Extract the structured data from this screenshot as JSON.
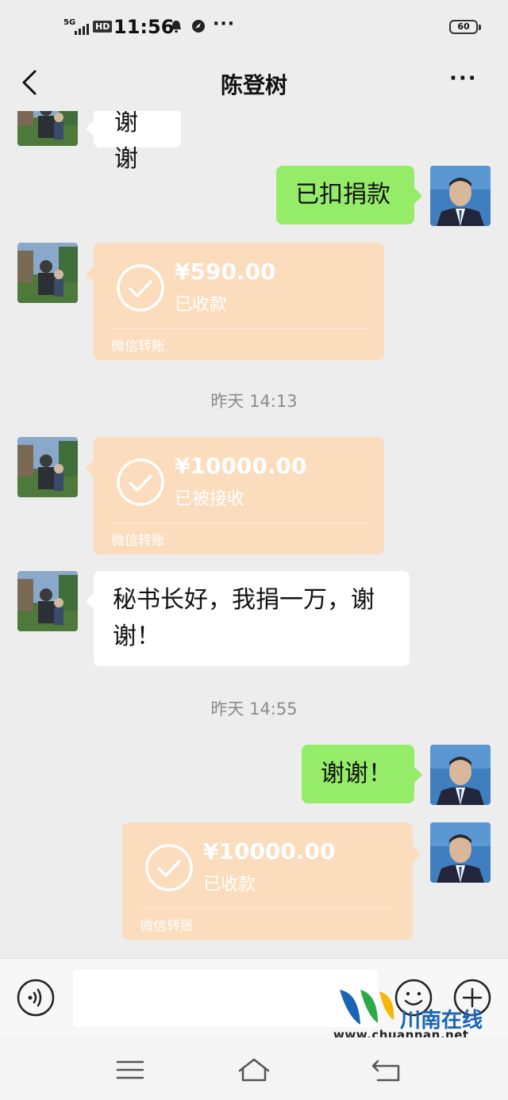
{
  "status_bar": {
    "network": "5G",
    "hd": "HD",
    "time": "11:56",
    "more": "···",
    "battery": "60"
  },
  "header": {
    "title": "陈登树",
    "more": "···"
  },
  "messages": {
    "m0": {
      "text": "谢谢"
    },
    "m1": {
      "text": "已扣捐款"
    },
    "m2": {
      "amount": "¥590.00",
      "status": "已收款",
      "footer": "微信转账"
    },
    "t1": {
      "text": "昨天 14:13"
    },
    "m3": {
      "amount": "¥10000.00",
      "status": "已被接收",
      "footer": "微信转账"
    },
    "m4": {
      "line1": "秘书长好，我捐一万，谢",
      "line2": "谢！"
    },
    "t2": {
      "text": "昨天 14:55"
    },
    "m5": {
      "text": "谢谢！"
    },
    "m6": {
      "amount": "¥10000.00",
      "status": "已收款",
      "footer": "微信转账"
    }
  },
  "input": {
    "placeholder": ""
  },
  "watermark": {
    "name": "川南在线",
    "url": "www.chuannan.net"
  },
  "colors": {
    "background": "#ededed",
    "bubble_green": "#95ec69",
    "transfer_received": "#fbdcbd"
  },
  "icons": {
    "back": "chevron-left-icon",
    "voice": "voice-icon",
    "emoji": "emoji-icon",
    "plus": "plus-icon",
    "check": "check-circle-icon"
  }
}
